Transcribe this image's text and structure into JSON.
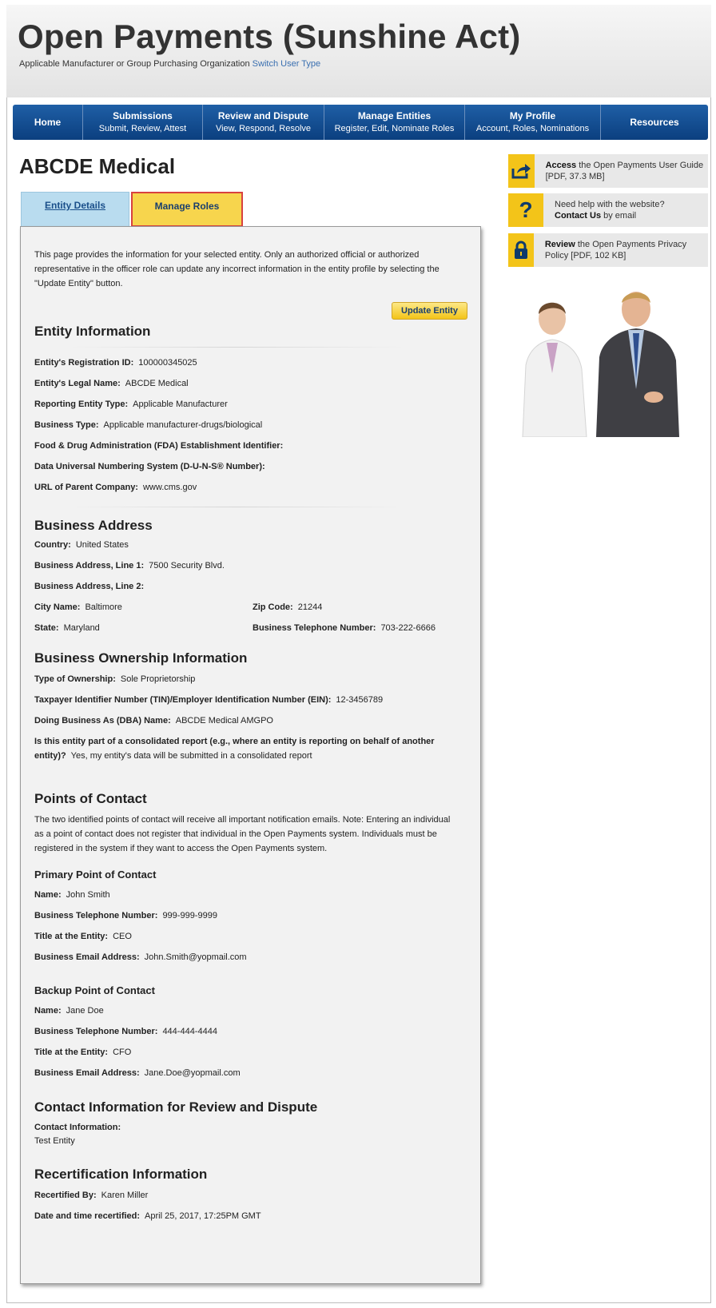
{
  "site": {
    "title": "Open Payments (Sunshine Act)",
    "user_type_text": "Applicable Manufacturer or Group Purchasing Organization",
    "switch_link": "Switch User Type"
  },
  "nav": {
    "home": "Home",
    "items": [
      {
        "top": "Submissions",
        "sub": "Submit, Review, Attest"
      },
      {
        "top": "Review and Dispute",
        "sub": "View, Respond, Resolve"
      },
      {
        "top": "Manage Entities",
        "sub": "Register, Edit, Nominate Roles"
      },
      {
        "top": "My Profile",
        "sub": "Account, Roles, Nominations"
      }
    ],
    "resources": "Resources"
  },
  "entity_name": "ABCDE Medical",
  "tabs": {
    "details": "Entity Details",
    "roles": "Manage Roles"
  },
  "intro": "This page provides the information for your selected entity. Only an authorized official or authorized representative in the officer role can update any incorrect information in the entity profile by selecting the \"Update Entity\" button.",
  "update_button": "Update Entity",
  "entity_info": {
    "heading": "Entity Information",
    "registration_id_label": "Entity's Registration ID:",
    "registration_id": "100000345025",
    "legal_name_label": "Entity's Legal Name:",
    "legal_name": "ABCDE Medical",
    "reporting_type_label": "Reporting Entity Type:",
    "reporting_type": "Applicable Manufacturer",
    "business_type_label": "Business Type:",
    "business_type": "Applicable manufacturer-drugs/biological",
    "fda_label": "Food & Drug Administration (FDA) Establishment Identifier:",
    "duns_label": "Data Universal Numbering System (D-U-N-S® Number):",
    "url_label": "URL of Parent Company:",
    "url": "www.cms.gov"
  },
  "business_address": {
    "heading": "Business Address",
    "country_label": "Country:",
    "country": "United States",
    "line1_label": "Business Address, Line 1:",
    "line1": "7500 Security Blvd.",
    "line2_label": "Business Address, Line 2:",
    "city_label": "City Name:",
    "city": "Baltimore",
    "zip_label": "Zip Code:",
    "zip": "21244",
    "state_label": "State:",
    "state": "Maryland",
    "phone_label": "Business Telephone Number:",
    "phone": "703-222-6666"
  },
  "ownership": {
    "heading": "Business Ownership Information",
    "type_label": "Type of Ownership:",
    "type": "Sole Proprietorship",
    "tin_label": "Taxpayer Identifier Number (TIN)/Employer Identification Number (EIN):",
    "tin": "12-3456789",
    "dba_label": "Doing Business As (DBA) Name:",
    "dba": "ABCDE Medical AMGPO",
    "consolidated_label": "Is this entity part of a consolidated report (e.g., where an entity is reporting on behalf of another entity)?",
    "consolidated": "Yes, my entity's data will be submitted in a consolidated report"
  },
  "contacts": {
    "heading": "Points of Contact",
    "note": "The two identified points of contact will receive all important notification emails. Note: Entering an individual as a point of contact does not register that individual in the Open Payments system. Individuals must be registered in the system if they want to access the Open Payments system.",
    "primary": {
      "heading": "Primary Point of Contact",
      "name_label": "Name:",
      "name": "John Smith",
      "phone_label": "Business Telephone Number:",
      "phone": "999-999-9999",
      "title_label": "Title at the Entity:",
      "title": "CEO",
      "email_label": "Business Email Address:",
      "email": "John.Smith@yopmail.com"
    },
    "backup": {
      "heading": "Backup Point of Contact",
      "name_label": "Name:",
      "name": "Jane Doe",
      "phone_label": "Business Telephone Number:",
      "phone": "444-444-4444",
      "title_label": "Title at the Entity:",
      "title": "CFO",
      "email_label": "Business Email Address:",
      "email": "Jane.Doe@yopmail.com"
    }
  },
  "review_contact": {
    "heading": "Contact Information for Review and Dispute",
    "label": "Contact Information:",
    "value": "Test Entity"
  },
  "recert": {
    "heading": "Recertification Information",
    "by_label": "Recertified By:",
    "by": "Karen Miller",
    "date_label": "Date and time recertified:",
    "date": "April 25, 2017, 17:25PM GMT"
  },
  "sidebar": {
    "guide_bold": "Access",
    "guide_text": "the Open Payments User Guide [PDF, 37.3 MB]",
    "help_text": "Need help with the website?",
    "help_bold": "Contact Us",
    "help_suffix": "by email",
    "privacy_bold": "Review",
    "privacy_text": "the Open Payments Privacy Policy [PDF, 102 KB]"
  },
  "colors": {
    "nav": "#0b3f7f",
    "accent": "#f3c419",
    "tab_active": "#b9dcef",
    "tab_highlight_border": "#d8413f"
  }
}
